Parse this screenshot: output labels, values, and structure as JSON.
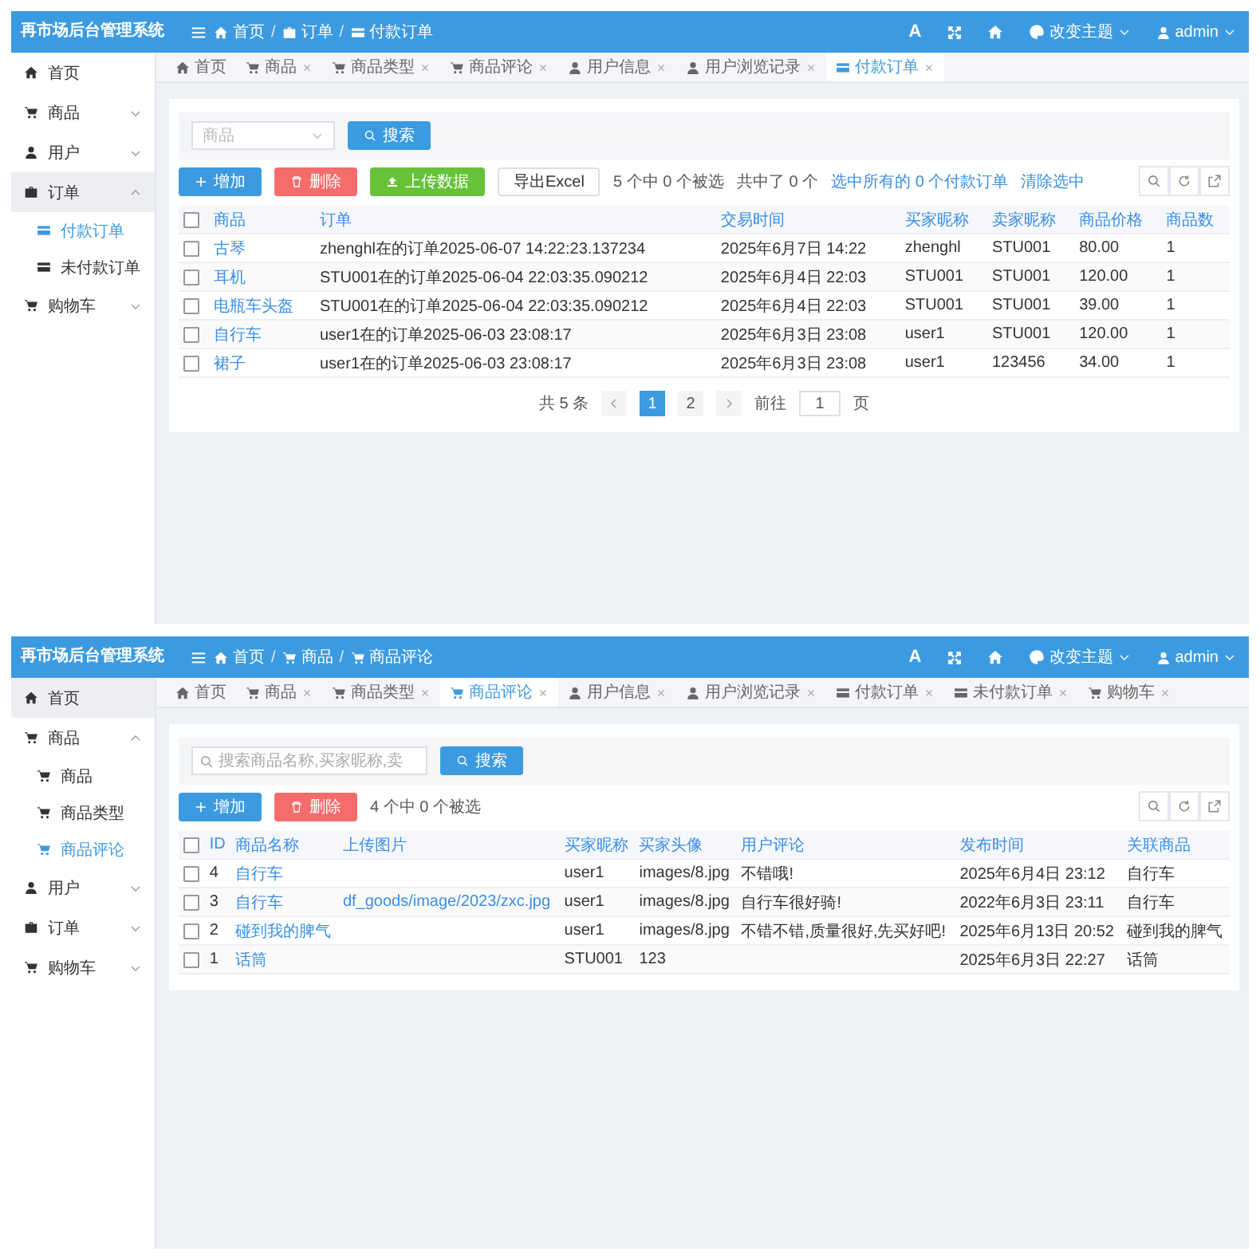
{
  "panels": [
    {
      "app_title": "再市场后台管理系统",
      "breadcrumb": [
        {
          "label": "首页",
          "kind": "home"
        },
        {
          "label": "订单",
          "kind": "order"
        },
        {
          "label": "付款订单",
          "kind": "payment"
        }
      ],
      "breadcrumb_separators": [
        "/",
        "/"
      ],
      "header_actions": {
        "font_button": "A",
        "theme": "改变主题",
        "user": "admin"
      },
      "sidebar": [
        {
          "label": "首页",
          "kind": "home",
          "hovered": false
        },
        {
          "label": "商品",
          "kind": "goods",
          "hovered": false,
          "expanded": false
        },
        {
          "label": "用户",
          "kind": "user",
          "hovered": false,
          "expanded": false
        },
        {
          "label": "订单",
          "kind": "order",
          "hovered": true,
          "expanded": true,
          "children": [
            {
              "label": "付款订单",
              "kind": "payment",
              "selected": true
            },
            {
              "label": "未付款订单",
              "kind": "payment",
              "selected": false
            }
          ]
        },
        {
          "label": "购物车",
          "kind": "goods",
          "hovered": false,
          "expanded": false
        }
      ],
      "tabs": [
        {
          "label": "首页",
          "kind": "home",
          "selected": false,
          "closable": false
        },
        {
          "label": "商品",
          "kind": "goods",
          "selected": false,
          "closable": true
        },
        {
          "label": "商品类型",
          "kind": "goods",
          "selected": false,
          "closable": true
        },
        {
          "label": "商品评论",
          "kind": "goods",
          "selected": false,
          "closable": true
        },
        {
          "label": "用户信息",
          "kind": "user",
          "selected": false,
          "closable": true
        },
        {
          "label": "用户浏览记录",
          "kind": "user",
          "selected": false,
          "closable": true
        },
        {
          "label": "付款订单",
          "kind": "payment",
          "selected": true,
          "closable": true
        }
      ],
      "search": {
        "kind": "select",
        "placeholder": "商品",
        "button": "搜索"
      },
      "toolbar": {
        "buttons": [
          {
            "label": "增加",
            "kind": "add"
          },
          {
            "label": "删除",
            "kind": "delete"
          },
          {
            "label": "上传数据",
            "kind": "upload"
          },
          {
            "label": "导出Excel",
            "kind": "export"
          }
        ],
        "selection": "5 个中 0 个被选",
        "total": "共中了 0 个",
        "links": [
          "选中所有的 0 个付款订单",
          "清除选中"
        ]
      },
      "table": {
        "all_checked": false,
        "columns": [
          {
            "label": "商品",
            "link": true
          },
          {
            "label": "订单",
            "link": false
          },
          {
            "label": "交易时间",
            "link": false
          },
          {
            "label": "买家昵称",
            "link": false
          },
          {
            "label": "卖家昵称",
            "link": false
          },
          {
            "label": "商品价格",
            "link": false
          },
          {
            "label": "商品数",
            "link": false
          }
        ],
        "rows": [
          {
            "checked": false,
            "cells": [
              "古琴",
              "zhenghl在的订单2025-06-07 14:22:23.137234",
              "2025年6月7日 14:22",
              "zhenghl",
              "STU001",
              "80.00",
              "1"
            ]
          },
          {
            "checked": false,
            "cells": [
              "耳机",
              "STU001在的订单2025-06-04 22:03:35.090212",
              "2025年6月4日 22:03",
              "STU001",
              "STU001",
              "120.00",
              "1"
            ]
          },
          {
            "checked": false,
            "cells": [
              "电瓶车头盔",
              "STU001在的订单2025-06-04 22:03:35.090212",
              "2025年6月4日 22:03",
              "STU001",
              "STU001",
              "39.00",
              "1"
            ]
          },
          {
            "checked": false,
            "cells": [
              "自行车",
              "user1在的订单2025-06-03 23:08:17",
              "2025年6月3日 23:08",
              "user1",
              "STU001",
              "120.00",
              "1"
            ]
          },
          {
            "checked": false,
            "cells": [
              "裙子",
              "user1在的订单2025-06-03 23:08:17",
              "2025年6月3日 23:08",
              "user1",
              "123456",
              "34.00",
              "1"
            ]
          }
        ]
      },
      "pagination": {
        "total": "共 5 条",
        "pages": [
          {
            "label": "1",
            "selected": true
          },
          {
            "label": "2",
            "selected": false
          }
        ],
        "goto": "前往",
        "page_input": "1",
        "unit": "页"
      }
    },
    {
      "app_title": "再市场后台管理系统",
      "breadcrumb": [
        {
          "label": "首页",
          "kind": "home"
        },
        {
          "label": "商品",
          "kind": "goods"
        },
        {
          "label": "商品评论",
          "kind": "goods"
        }
      ],
      "breadcrumb_separators": [
        "/",
        "/"
      ],
      "header_actions": {
        "font_button": "A",
        "theme": "改变主题",
        "user": "admin"
      },
      "sidebar": [
        {
          "label": "首页",
          "kind": "home",
          "hovered": true
        },
        {
          "label": "商品",
          "kind": "goods",
          "hovered": false,
          "expanded": true,
          "children": [
            {
              "label": "商品",
              "kind": "goods",
              "selected": false
            },
            {
              "label": "商品类型",
              "kind": "goods",
              "selected": false
            },
            {
              "label": "商品评论",
              "kind": "goods",
              "selected": true
            }
          ]
        },
        {
          "label": "用户",
          "kind": "user",
          "hovered": false,
          "expanded": false
        },
        {
          "label": "订单",
          "kind": "order",
          "hovered": false,
          "expanded": false
        },
        {
          "label": "购物车",
          "kind": "goods",
          "hovered": false,
          "expanded": false
        }
      ],
      "tabs": [
        {
          "label": "首页",
          "kind": "home",
          "selected": false,
          "closable": false
        },
        {
          "label": "商品",
          "kind": "goods",
          "selected": false,
          "closable": true
        },
        {
          "label": "商品类型",
          "kind": "goods",
          "selected": false,
          "closable": true
        },
        {
          "label": "商品评论",
          "kind": "goods",
          "selected": true,
          "closable": true
        },
        {
          "label": "用户信息",
          "kind": "user",
          "selected": false,
          "closable": true
        },
        {
          "label": "用户浏览记录",
          "kind": "user",
          "selected": false,
          "closable": true
        },
        {
          "label": "付款订单",
          "kind": "payment",
          "selected": false,
          "closable": true
        },
        {
          "label": "未付款订单",
          "kind": "payment",
          "selected": false,
          "closable": true
        },
        {
          "label": "购物车",
          "kind": "goods",
          "selected": false,
          "closable": true
        }
      ],
      "search": {
        "kind": "input",
        "placeholder": "搜索商品名称,买家昵称,卖",
        "button": "搜索"
      },
      "toolbar": {
        "buttons": [
          {
            "label": "增加",
            "kind": "add"
          },
          {
            "label": "删除",
            "kind": "delete"
          }
        ],
        "selection": "4 个中 0 个被选"
      },
      "table": {
        "all_checked": false,
        "columns": [
          {
            "label": "ID",
            "link": false
          },
          {
            "label": "商品名称",
            "link": true
          },
          {
            "label": "上传图片",
            "link": true
          },
          {
            "label": "买家昵称",
            "link": false
          },
          {
            "label": "买家头像",
            "link": false
          },
          {
            "label": "用户评论",
            "link": false
          },
          {
            "label": "发布时间",
            "link": false
          },
          {
            "label": "关联商品",
            "link": false
          }
        ],
        "rows": [
          {
            "checked": false,
            "cells": [
              "4",
              "自行车",
              null,
              "user1",
              "images/8.jpg",
              "不错哦!",
              "2025年6月4日 23:12",
              "自行车"
            ]
          },
          {
            "checked": false,
            "cells": [
              "3",
              "自行车",
              "df_goods/image/2023/zxc.jpg",
              "user1",
              "images/8.jpg",
              "自行车很好骑!",
              "2022年6月3日 23:11",
              "自行车"
            ]
          },
          {
            "checked": false,
            "cells": [
              "2",
              "碰到我的脾气",
              null,
              "user1",
              "images/8.jpg",
              "不错不错,质量很好,先买好吧!",
              "2025年6月13日 20:52",
              "碰到我的脾气"
            ]
          },
          {
            "checked": false,
            "cells": [
              "1",
              "话筒",
              null,
              "STU001",
              "123",
              null,
              "2025年6月3日 22:27",
              "话筒"
            ]
          }
        ]
      }
    }
  ]
}
